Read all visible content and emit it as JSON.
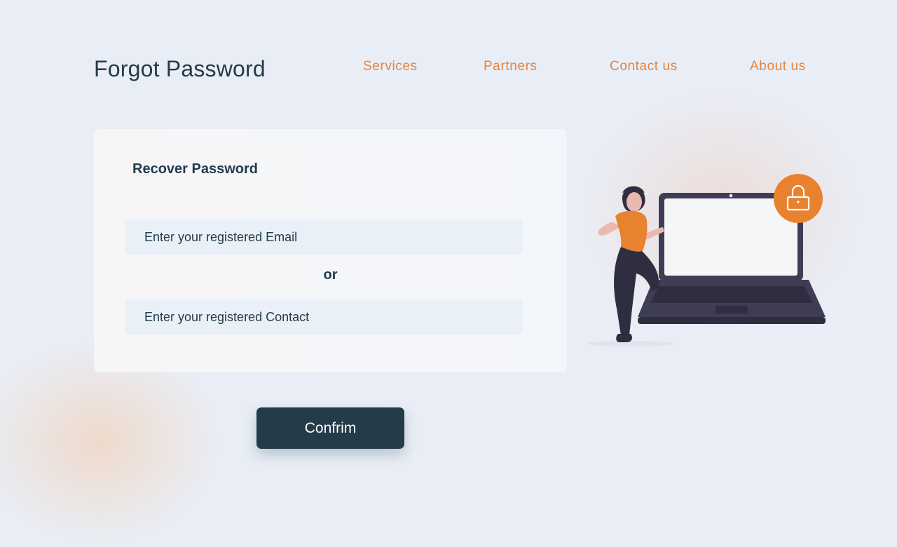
{
  "header": {
    "title": "Forgot Password"
  },
  "nav": {
    "items": [
      {
        "label": "Services"
      },
      {
        "label": "Partners"
      },
      {
        "label": "Contact us"
      },
      {
        "label": "About us"
      }
    ]
  },
  "form": {
    "title": "Recover Password",
    "email_placeholder": "Enter your registered Email",
    "or_label": "or",
    "contact_placeholder": "Enter your registered Contact",
    "confirm_label": "Confrim"
  },
  "illustration": {
    "icon": "lock-icon"
  },
  "colors": {
    "accent": "#e8823b",
    "primary": "#243b4a",
    "background": "#e9eef6",
    "field_bg": "#eaf0f8",
    "laptop": "#3f3d56"
  }
}
